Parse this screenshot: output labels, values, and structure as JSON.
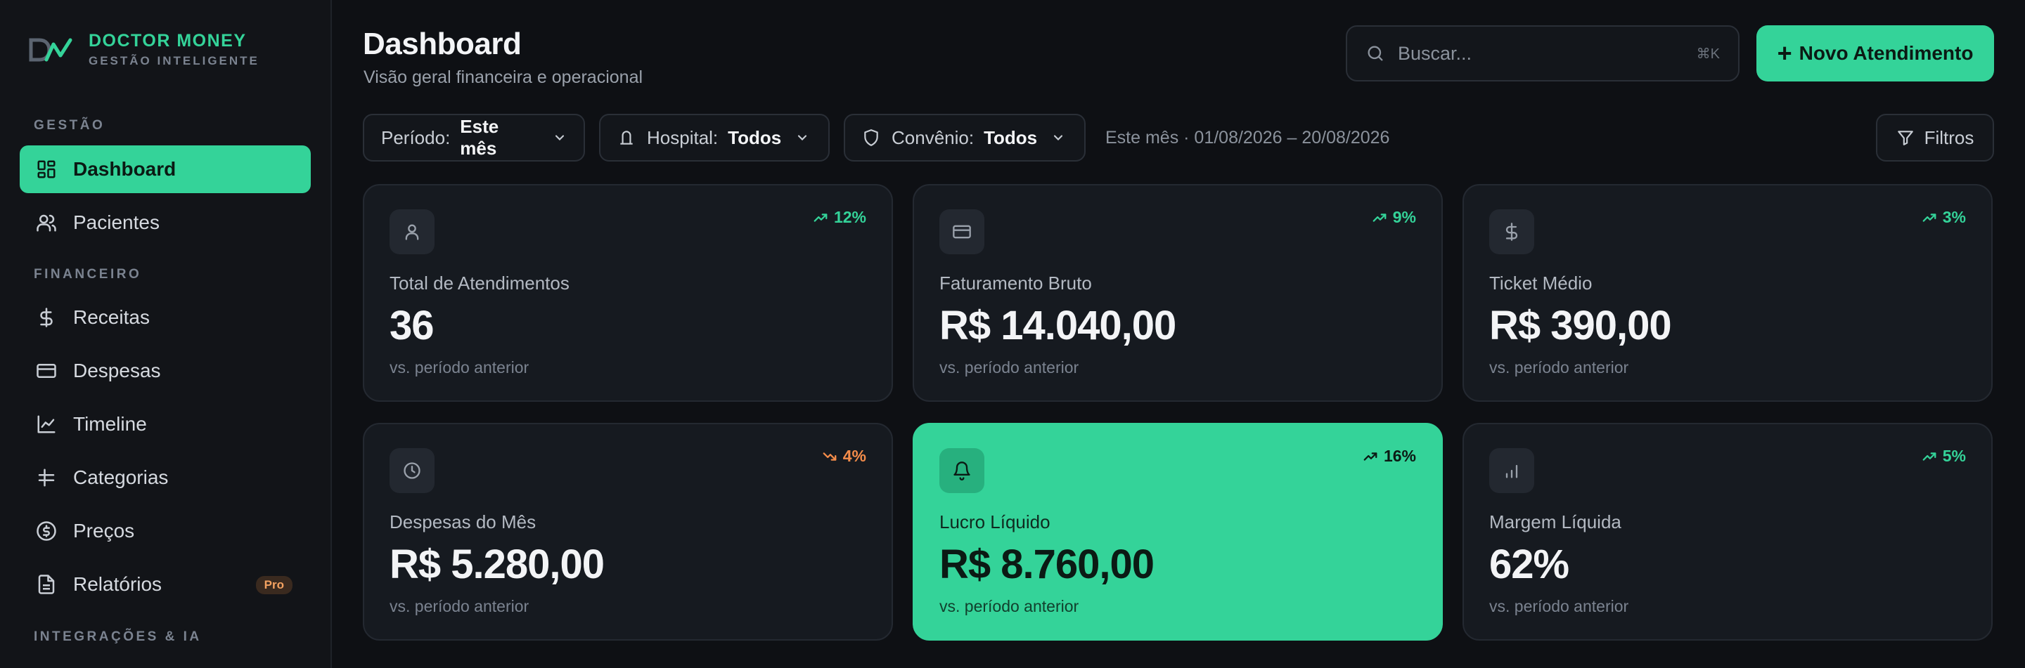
{
  "brand": {
    "name": "DOCTOR MONEY",
    "tagline": "GESTÃO INTELIGENTE",
    "accent": "#34d399"
  },
  "sidebar": {
    "sections": [
      {
        "label": "GESTÃO"
      },
      {
        "label": "FINANCEIRO"
      },
      {
        "label": "INTEGRAÇÕES & IA"
      }
    ],
    "items": [
      {
        "label": "Dashboard",
        "icon": "grid-icon",
        "active": true
      },
      {
        "label": "Pacientes",
        "icon": "users-icon"
      },
      {
        "label": "Receitas",
        "icon": "dollar-icon"
      },
      {
        "label": "Despesas",
        "icon": "credit-card-icon"
      },
      {
        "label": "Timeline",
        "icon": "line-chart-icon"
      },
      {
        "label": "Categorias",
        "icon": "hash-icon"
      },
      {
        "label": "Preços",
        "icon": "circle-dollar-icon"
      },
      {
        "label": "Relatórios",
        "icon": "file-icon",
        "badge": "Pro"
      }
    ]
  },
  "header": {
    "title": "Dashboard",
    "subtitle": "Visão geral financeira e operacional",
    "search_placeholder": "Buscar...",
    "search_shortcut": "⌘K",
    "new_button": "Novo Atendimento"
  },
  "filters": {
    "periodo": {
      "label": "Período:",
      "value": "Este mês"
    },
    "hospital": {
      "label": "Hospital:",
      "value": "Todos"
    },
    "convenio": {
      "label": "Convênio:",
      "value": "Todos"
    },
    "date_range": "Este mês · 01/08/2026 – 20/08/2026",
    "filtros_button": "Filtros"
  },
  "cards": [
    {
      "label": "Total de Atendimentos",
      "value": "36",
      "trend": "12%",
      "direction": "up",
      "foot": "vs. período anterior",
      "icon": "user-icon"
    },
    {
      "label": "Faturamento Bruto",
      "value": "R$ 14.040,00",
      "trend": "9%",
      "direction": "up",
      "foot": "vs. período anterior",
      "icon": "credit-card-icon"
    },
    {
      "label": "Ticket Médio",
      "value": "R$ 390,00",
      "trend": "3%",
      "direction": "up",
      "foot": "vs. período anterior",
      "icon": "dollar-icon"
    },
    {
      "label": "Despesas do Mês",
      "value": "R$ 5.280,00",
      "trend": "4%",
      "direction": "down",
      "foot": "vs. período anterior",
      "icon": "clock-icon"
    },
    {
      "label": "Lucro Líquido",
      "value": "R$ 8.760,00",
      "trend": "16%",
      "direction": "up",
      "foot": "vs. período anterior",
      "icon": "bell-icon",
      "highlight": true
    },
    {
      "label": "Margem Líquida",
      "value": "62%",
      "trend": "5%",
      "direction": "up",
      "foot": "vs. período anterior",
      "icon": "bar-chart-icon"
    }
  ],
  "colors": {
    "accent": "#34d399",
    "negative": "#f48c4a",
    "background": "#0e1014",
    "card": "#161a20"
  }
}
